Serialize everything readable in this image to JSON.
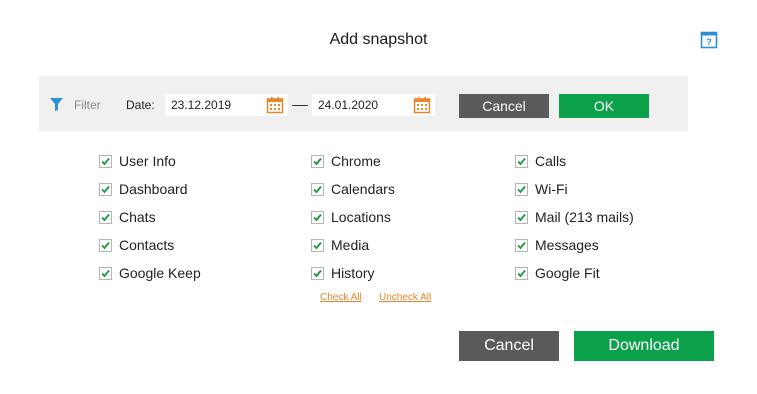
{
  "dialog": {
    "title": "Add snapshot",
    "help_icon": "help-book-icon"
  },
  "filter": {
    "filter_icon": "funnel-icon",
    "filter_label": "Filter",
    "date_label": "Date:",
    "date_from": "23.12.2019",
    "date_to": "24.01.2020",
    "calendar_icon": "calendar-icon",
    "cancel_label": "Cancel",
    "ok_label": "OK"
  },
  "checkboxes": {
    "col1": [
      {
        "label": "User Info",
        "checked": true
      },
      {
        "label": "Dashboard",
        "checked": true
      },
      {
        "label": "Chats",
        "checked": true
      },
      {
        "label": "Contacts",
        "checked": true
      },
      {
        "label": "Google Keep",
        "checked": true
      }
    ],
    "col2": [
      {
        "label": "Chrome",
        "checked": true
      },
      {
        "label": "Calendars",
        "checked": true
      },
      {
        "label": "Locations",
        "checked": true
      },
      {
        "label": "Media",
        "checked": true
      },
      {
        "label": "History",
        "checked": true
      }
    ],
    "col3": [
      {
        "label": "Calls",
        "checked": true
      },
      {
        "label": "Wi-Fi",
        "checked": true
      },
      {
        "label": "Mail (213 mails)",
        "checked": true
      },
      {
        "label": "Messages",
        "checked": true
      },
      {
        "label": "Google Fit",
        "checked": true
      }
    ]
  },
  "links": {
    "check_all": "Check All",
    "uncheck_all": "Uncheck All"
  },
  "footer": {
    "cancel_label": "Cancel",
    "download_label": "Download"
  },
  "colors": {
    "accent_green": "#0aa14a",
    "button_gray": "#5a5a5a",
    "filter_bar_bg": "#f0f0f0",
    "link_orange": "#e8862b",
    "icon_blue": "#2a8fd6",
    "checkmark_green": "#1a9a3e"
  }
}
